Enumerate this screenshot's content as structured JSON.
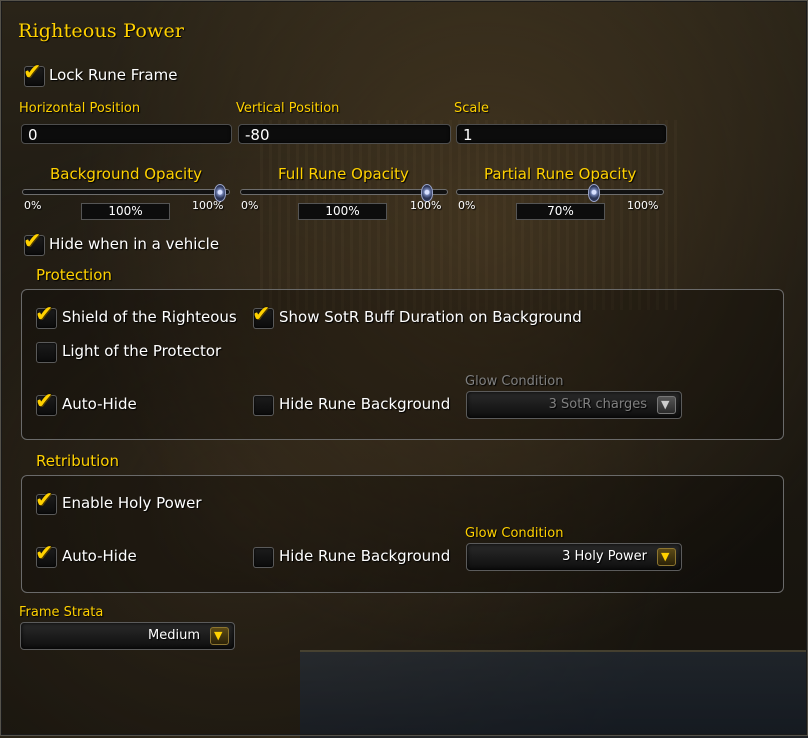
{
  "title": "Righteous Power",
  "lock_rune_frame": {
    "label": "Lock Rune Frame",
    "checked": true
  },
  "position": {
    "horizontal_label": "Horizontal Position",
    "horizontal_value": "0",
    "vertical_label": "Vertical Position",
    "vertical_value": "-80",
    "scale_label": "Scale",
    "scale_value": "1"
  },
  "sliders": [
    {
      "label": "Background Opacity",
      "min": "0%",
      "max": "100%",
      "value": "100%",
      "fraction": 1.0
    },
    {
      "label": "Full Rune Opacity",
      "min": "0%",
      "max": "100%",
      "value": "100%",
      "fraction": 1.0
    },
    {
      "label": "Partial Rune Opacity",
      "min": "0%",
      "max": "100%",
      "value": "70%",
      "fraction": 0.7
    }
  ],
  "hide_vehicle": {
    "label": "Hide when in a vehicle",
    "checked": true
  },
  "protection": {
    "header": "Protection",
    "shield": {
      "label": "Shield of the Righteous",
      "checked": true
    },
    "sotr_buff": {
      "label": "Show SotR Buff Duration on Background",
      "checked": true
    },
    "light": {
      "label": "Light of the Protector",
      "checked": false
    },
    "auto_hide": {
      "label": "Auto-Hide",
      "checked": true
    },
    "hide_bg": {
      "label": "Hide Rune Background",
      "checked": false
    },
    "glow_label": "Glow Condition",
    "glow_value": "3 SotR charges"
  },
  "retribution": {
    "header": "Retribution",
    "enable": {
      "label": "Enable Holy Power",
      "checked": true
    },
    "auto_hide": {
      "label": "Auto-Hide",
      "checked": true
    },
    "hide_bg": {
      "label": "Hide Rune Background",
      "checked": false
    },
    "glow_label": "Glow Condition",
    "glow_value": "3 Holy Power"
  },
  "frame_strata": {
    "label": "Frame Strata",
    "value": "Medium"
  },
  "icons": {
    "check": "checkmark-icon",
    "dropdown": "chevron-down-icon"
  },
  "colors": {
    "accent_gold": "#ffd100",
    "disabled_gray": "#808080"
  }
}
